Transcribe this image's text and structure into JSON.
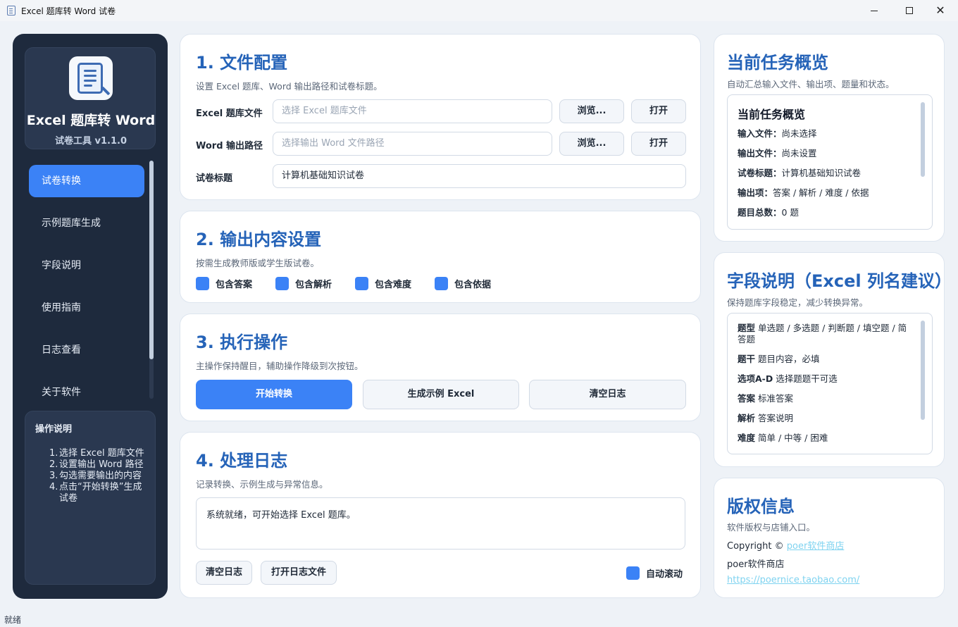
{
  "window": {
    "title": "Excel 题库转 Word 试卷"
  },
  "sidebar": {
    "brand_name": "Excel 题库转 Word",
    "brand_version": "试卷工具 v1.1.0",
    "items": [
      {
        "label": "试卷转换",
        "active": true
      },
      {
        "label": "示例题库生成",
        "active": false
      },
      {
        "label": "字段说明",
        "active": false
      },
      {
        "label": "使用指南",
        "active": false
      },
      {
        "label": "日志查看",
        "active": false
      },
      {
        "label": "关于软件",
        "active": false
      }
    ],
    "ops_title": "操作说明",
    "ops_steps": [
      {
        "num": "1.",
        "text": "选择 Excel 题库文件"
      },
      {
        "num": "2.",
        "text": "设置输出 Word 路径"
      },
      {
        "num": "3.",
        "text": "勾选需要输出的内容"
      },
      {
        "num": "4.",
        "text": "点击“开始转换”生成试卷"
      }
    ]
  },
  "file_config": {
    "title": "1. 文件配置",
    "desc": "设置 Excel 题库、Word 输出路径和试卷标题。",
    "excel_label": "Excel 题库文件",
    "excel_placeholder": "选择 Excel 题库文件",
    "word_label": "Word 输出路径",
    "word_placeholder": "选择输出 Word 文件路径",
    "title_label": "试卷标题",
    "title_value": "计算机基础知识试卷",
    "browse_label": "浏览...",
    "open_label": "打开"
  },
  "output_settings": {
    "title": "2. 输出内容设置",
    "desc": "按需生成教师版或学生版试卷。",
    "options": [
      {
        "label": "包含答案",
        "checked": true
      },
      {
        "label": "包含解析",
        "checked": true
      },
      {
        "label": "包含难度",
        "checked": true
      },
      {
        "label": "包含依据",
        "checked": true
      }
    ]
  },
  "actions": {
    "title": "3. 执行操作",
    "desc": "主操作保持醒目，辅助操作降级到次按钮。",
    "start_label": "开始转换",
    "sample_label": "生成示例 Excel",
    "clear_label": "清空日志"
  },
  "log": {
    "title": "4. 处理日志",
    "desc": "记录转换、示例生成与异常信息。",
    "content": "系统就绪，可开始选择 Excel 题库。",
    "clear_label": "清空日志",
    "open_file_label": "打开日志文件",
    "autoscroll_label": "自动滚动",
    "autoscroll_checked": true
  },
  "overview": {
    "title": "当前任务概览",
    "desc": "自动汇总输入文件、输出项、题量和状态。",
    "box_title": "当前任务概览",
    "rows": [
      {
        "key": "输入文件：",
        "value": "尚未选择"
      },
      {
        "key": "输出文件：",
        "value": "尚未设置"
      },
      {
        "key": "试卷标题：",
        "value": "计算机基础知识试卷"
      },
      {
        "key": "输出项：",
        "value": "答案 / 解析 / 难度 / 依据"
      },
      {
        "key": "题目总数：",
        "value": "0 题"
      }
    ]
  },
  "fields": {
    "title": "字段说明（Excel 列名建议）",
    "desc": "保持题库字段稳定，减少转换异常。",
    "rows": [
      {
        "key": "题型",
        "value": "单选题 / 多选题 / 判断题 / 填空题 / 简答题"
      },
      {
        "key": "题干",
        "value": "题目内容，必填"
      },
      {
        "key": "选项A-D",
        "value": "选择题题干可选"
      },
      {
        "key": "答案",
        "value": "标准答案"
      },
      {
        "key": "解析",
        "value": "答案说明"
      },
      {
        "key": "难度",
        "value": "简单 / 中等 / 困难"
      }
    ]
  },
  "copyright": {
    "title": "版权信息",
    "desc": "软件版权与店铺入口。",
    "copy_prefix": "Copyright ©",
    "copy_link": "poer软件商店",
    "shop_name": "poer软件商店",
    "url": "https://poernice.taobao.com/"
  },
  "status": {
    "text": "就绪"
  },
  "colors": {
    "accent": "#3b82f6",
    "heading": "#2563b8",
    "sidebar_bg": "#1e2a3d"
  }
}
